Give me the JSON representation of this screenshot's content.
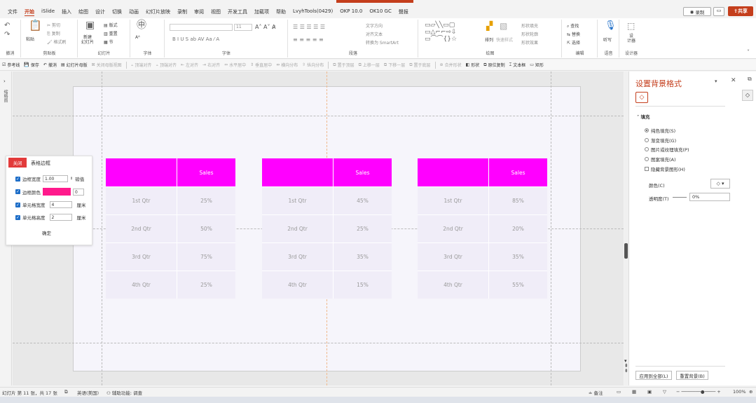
{
  "tabs": [
    "文件",
    "开始",
    "iSlide",
    "插入",
    "绘图",
    "设计",
    "切换",
    "动画",
    "幻灯片放映",
    "录制",
    "审阅",
    "视图",
    "开发工具",
    "加载项",
    "帮助",
    "LvyhTools(0429)",
    "OKP 10.0",
    "OK10 GC",
    "聲报"
  ],
  "active_tab_index": 1,
  "titlebar": {
    "record_label": "录制",
    "share_label": "共享"
  },
  "ribbon": {
    "groups": [
      "撤消",
      "剪贴板",
      "幻灯片",
      "字体",
      "段落",
      "绘图",
      "编辑",
      "语音",
      "设计器"
    ],
    "undo_label": "撤消",
    "paste_label": "粘贴",
    "cut_label": "剪切",
    "copy_label": "复制",
    "format_label": "格式刷",
    "new_slide_label": "新建\n幻灯片",
    "layout_label": "版式",
    "reset_label": "重置",
    "section_label": "节",
    "font_label": "字体",
    "font_size": "11",
    "text_dir_label": "文字方向",
    "align_text_label": "对齐文本",
    "smartart_label": "转换为 SmartArt",
    "arrange_label": "排列",
    "quick_styles_label": "快速样式",
    "shape_fill_label": "形状填充",
    "shape_outline_label": "形状轮廓",
    "shape_effects_label": "形状效果",
    "find_label": "查找",
    "replace_label": "替换",
    "select_label": "选择",
    "listen_label": "听写",
    "designer_label": "设\n计器"
  },
  "qabar": [
    {
      "label": "参考线",
      "dim": false
    },
    {
      "label": "保存",
      "dim": false
    },
    {
      "label": "撤消",
      "dim": false
    },
    {
      "label": "幻灯片母版",
      "dim": false
    },
    {
      "label": "关闭母版视图",
      "dim": true
    },
    {
      "label": "顶端对齐",
      "dim": true
    },
    {
      "label": "顶端对齐",
      "dim": true
    },
    {
      "label": "左对齐",
      "dim": true
    },
    {
      "label": "右对齐",
      "dim": true
    },
    {
      "label": "水平居中",
      "dim": true
    },
    {
      "label": "垂直居中",
      "dim": true
    },
    {
      "label": "横向分布",
      "dim": true
    },
    {
      "label": "纵向分布",
      "dim": true
    },
    {
      "label": "置于顶层",
      "dim": true
    },
    {
      "label": "上移一层",
      "dim": true
    },
    {
      "label": "下移一层",
      "dim": true
    },
    {
      "label": "置于底层",
      "dim": true
    },
    {
      "label": "合并形状",
      "dim": true
    },
    {
      "label": "形状",
      "dim": false
    },
    {
      "label": "原位复制",
      "dim": false
    },
    {
      "label": "文本框",
      "dim": false
    },
    {
      "label": "矩形",
      "dim": false
    }
  ],
  "tables": [
    {
      "header": [
        "",
        "Sales"
      ],
      "rows": [
        [
          "1st Qtr",
          "25%"
        ],
        [
          "2nd Qtr",
          "50%"
        ],
        [
          "3rd Qtr",
          "75%"
        ],
        [
          "4th Qtr",
          "25%"
        ]
      ]
    },
    {
      "header": [
        "",
        "Sales"
      ],
      "rows": [
        [
          "1st Qtr",
          "45%"
        ],
        [
          "2nd Qtr",
          "25%"
        ],
        [
          "3rd Qtr",
          "35%"
        ],
        [
          "4th Qtr",
          "15%"
        ]
      ]
    },
    {
      "header": [
        "",
        "Sales"
      ],
      "rows": [
        [
          "1st Qtr",
          "85%"
        ],
        [
          "2nd Qtr",
          "20%"
        ],
        [
          "3rd Qtr",
          "35%"
        ],
        [
          "4th Qtr",
          "55%"
        ]
      ]
    }
  ],
  "header_color": "#ff00ff",
  "dialog": {
    "close_label": "关闭",
    "title": "表格边框",
    "border_width_label": "边框宽度",
    "border_width_value": "1.00",
    "border_unit": "磅值",
    "border_color_label": "边框颜色",
    "border_color": "#ff1a8c",
    "border_color_value": "0",
    "cell_width_label": "单元格宽度",
    "cell_width_value": "4",
    "cell_height_label": "单元格高度",
    "cell_height_value": "2",
    "unit": "厘米",
    "ok_label": "确定"
  },
  "pane": {
    "title": "设置背景格式",
    "section": "填充",
    "options": [
      {
        "label": "纯色填充(S)",
        "type": "radio",
        "on": true
      },
      {
        "label": "渐变填充(G)",
        "type": "radio",
        "on": false
      },
      {
        "label": "图片或纹理填充(P)",
        "type": "radio",
        "on": false
      },
      {
        "label": "图案填充(A)",
        "type": "radio",
        "on": false
      },
      {
        "label": "隐藏背景图形(H)",
        "type": "check",
        "on": false
      }
    ],
    "color_label": "颜色(C)",
    "transparency_label": "透明度(T)",
    "transparency_value": "0%",
    "apply_all_label": "应用到全部(L)",
    "reset_bg_label": "重置背景(B)"
  },
  "status": {
    "slide_info": "幻灯片 第 11 张，共 17 张",
    "language": "英语(美国)",
    "accessibility": "辅助功能: 调查",
    "notes_label": "备注",
    "zoom": "100%"
  }
}
